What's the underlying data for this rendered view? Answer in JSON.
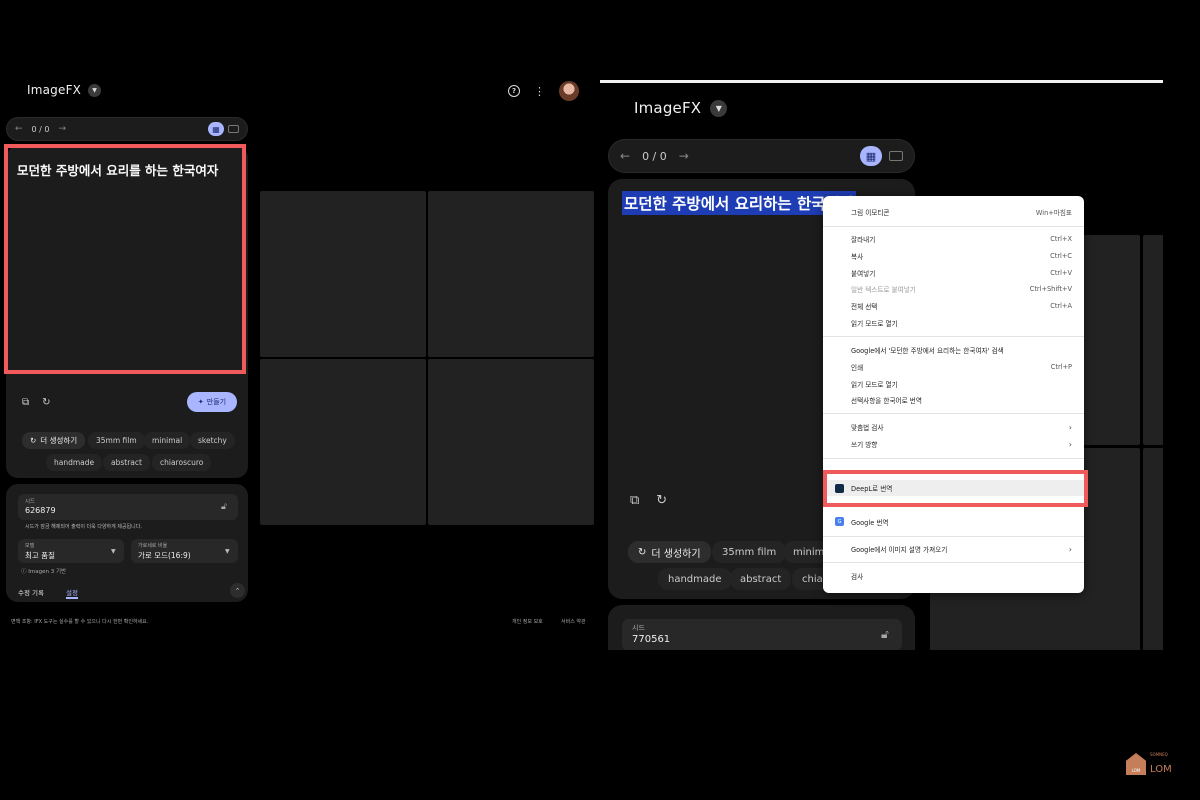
{
  "app": {
    "title": "ImageFX"
  },
  "left": {
    "nav_count": "0 / 0",
    "prompt": "모던한 주방에서 요리를 하는 한국여자",
    "make_label": "만들기",
    "chips": [
      "더 생성하기",
      "35mm film",
      "minimal",
      "sketchy",
      "handmade",
      "abstract",
      "chiaroscuro"
    ],
    "seed_label": "시드",
    "seed_value": "626879",
    "seed_note": "시드가 잠금 해제되어 출력이 더욱 다양하게 제공됩니다.",
    "quality_label": "모델",
    "quality_value": "최고 품질",
    "aspect_label": "가로세로 비율",
    "aspect_value": "가로 모드(16:9)",
    "model_note": "Imagen 3 기반",
    "tabs": [
      "수정 기록",
      "설정"
    ],
    "footer_left": "면책 조항: IFX 도구는 실수를 할 수 있으니 다시 한번 확인하세요.",
    "footer_links": [
      "개인 정보 보호",
      "서비스 약관"
    ]
  },
  "right": {
    "nav_count": "0 / 0",
    "prompt": "모던한 주방에서 요리하는 한국여자",
    "chips": [
      "더 생성하기",
      "35mm film",
      "minimal",
      "handmade",
      "abstract",
      "chiaroscuro"
    ],
    "seed_label": "시드",
    "seed_value": "770561"
  },
  "context_menu": {
    "items": [
      {
        "label": "그림 이모티콘",
        "shortcut": "Win+마침표"
      },
      {
        "label": "잘라내기",
        "shortcut": "Ctrl+X"
      },
      {
        "label": "복사",
        "shortcut": "Ctrl+C"
      },
      {
        "label": "붙여넣기",
        "shortcut": "Ctrl+V"
      },
      {
        "label": "일반 텍스트로 붙여넣기",
        "shortcut": "Ctrl+Shift+V"
      },
      {
        "label": "전체 선택",
        "shortcut": "Ctrl+A"
      },
      {
        "label": "읽기 모드로 열기",
        "shortcut": ""
      },
      {
        "label": "Google에서 '모던한 주방에서 요리하는 한국여자' 검색",
        "shortcut": ""
      },
      {
        "label": "인쇄",
        "shortcut": "Ctrl+P"
      },
      {
        "label": "읽기 모드로 열기",
        "shortcut": ""
      },
      {
        "label": "선택사항을 한국어로 번역",
        "shortcut": ""
      },
      {
        "label": "맞춤법 검사",
        "shortcut": ""
      },
      {
        "label": "쓰기 방향",
        "shortcut": ""
      },
      {
        "label": "DeepL로 번역",
        "shortcut": ""
      },
      {
        "label": "Google 번역",
        "shortcut": ""
      },
      {
        "label": "Google에서 이미지 설명 가져오기",
        "shortcut": ""
      },
      {
        "label": "검사",
        "shortcut": ""
      }
    ]
  },
  "watermark": {
    "text": "LOM",
    "sub": "SOMNEQ",
    "house": "LOM"
  },
  "colors": {
    "accent": "#a9b6ff",
    "highlight_border": "#f05a5a",
    "selection": "#1e3db5"
  }
}
